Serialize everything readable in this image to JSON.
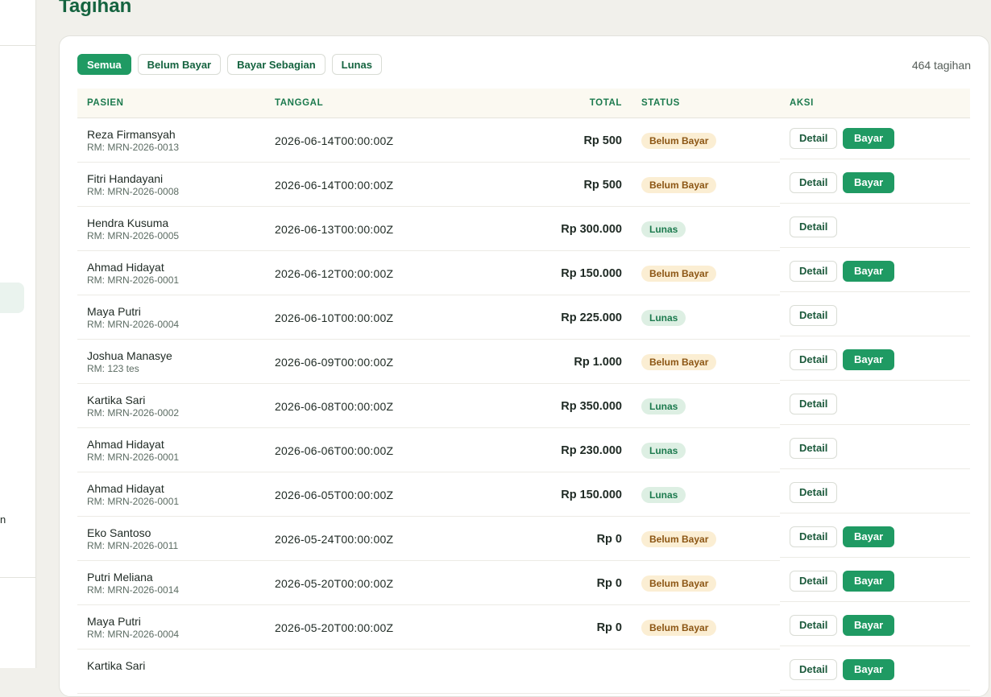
{
  "page": {
    "title": "Tagihan"
  },
  "sidebar": {
    "fragment": "n"
  },
  "filters": [
    {
      "label": "Semua",
      "active": true
    },
    {
      "label": "Belum Bayar",
      "active": false
    },
    {
      "label": "Bayar Sebagian",
      "active": false
    },
    {
      "label": "Lunas",
      "active": false
    }
  ],
  "summary": {
    "count": "464 tagihan"
  },
  "table": {
    "columns": {
      "patient": "PASIEN",
      "date": "TANGGAL",
      "total": "TOTAL",
      "status": "STATUS",
      "actions": "AKSI"
    },
    "detail_label": "Detail",
    "pay_label": "Bayar",
    "rows": [
      {
        "name": "Reza Firmansyah",
        "mrn": "RM: MRN-2026-0013",
        "date": "2026-06-14T00:00:00Z",
        "total": "Rp 500",
        "status": "Belum Bayar",
        "paid": false
      },
      {
        "name": "Fitri Handayani",
        "mrn": "RM: MRN-2026-0008",
        "date": "2026-06-14T00:00:00Z",
        "total": "Rp 500",
        "status": "Belum Bayar",
        "paid": false
      },
      {
        "name": "Hendra Kusuma",
        "mrn": "RM: MRN-2026-0005",
        "date": "2026-06-13T00:00:00Z",
        "total": "Rp 300.000",
        "status": "Lunas",
        "paid": true
      },
      {
        "name": "Ahmad Hidayat",
        "mrn": "RM: MRN-2026-0001",
        "date": "2026-06-12T00:00:00Z",
        "total": "Rp 150.000",
        "status": "Belum Bayar",
        "paid": false
      },
      {
        "name": "Maya Putri",
        "mrn": "RM: MRN-2026-0004",
        "date": "2026-06-10T00:00:00Z",
        "total": "Rp 225.000",
        "status": "Lunas",
        "paid": true
      },
      {
        "name": "Joshua Manasye",
        "mrn": "RM: 123 tes",
        "date": "2026-06-09T00:00:00Z",
        "total": "Rp 1.000",
        "status": "Belum Bayar",
        "paid": false
      },
      {
        "name": "Kartika Sari",
        "mrn": "RM: MRN-2026-0002",
        "date": "2026-06-08T00:00:00Z",
        "total": "Rp 350.000",
        "status": "Lunas",
        "paid": true
      },
      {
        "name": "Ahmad Hidayat",
        "mrn": "RM: MRN-2026-0001",
        "date": "2026-06-06T00:00:00Z",
        "total": "Rp 230.000",
        "status": "Lunas",
        "paid": true
      },
      {
        "name": "Ahmad Hidayat",
        "mrn": "RM: MRN-2026-0001",
        "date": "2026-06-05T00:00:00Z",
        "total": "Rp 150.000",
        "status": "Lunas",
        "paid": true
      },
      {
        "name": "Eko Santoso",
        "mrn": "RM: MRN-2026-0011",
        "date": "2026-05-24T00:00:00Z",
        "total": "Rp 0",
        "status": "Belum Bayar",
        "paid": false
      },
      {
        "name": "Putri Meliana",
        "mrn": "RM: MRN-2026-0014",
        "date": "2026-05-20T00:00:00Z",
        "total": "Rp 0",
        "status": "Belum Bayar",
        "paid": false
      },
      {
        "name": "Maya Putri",
        "mrn": "RM: MRN-2026-0004",
        "date": "2026-05-20T00:00:00Z",
        "total": "Rp 0",
        "status": "Belum Bayar",
        "paid": false
      },
      {
        "name": "Kartika Sari",
        "mrn": "",
        "date": "",
        "total": "",
        "status": "",
        "paid": false
      }
    ]
  }
}
